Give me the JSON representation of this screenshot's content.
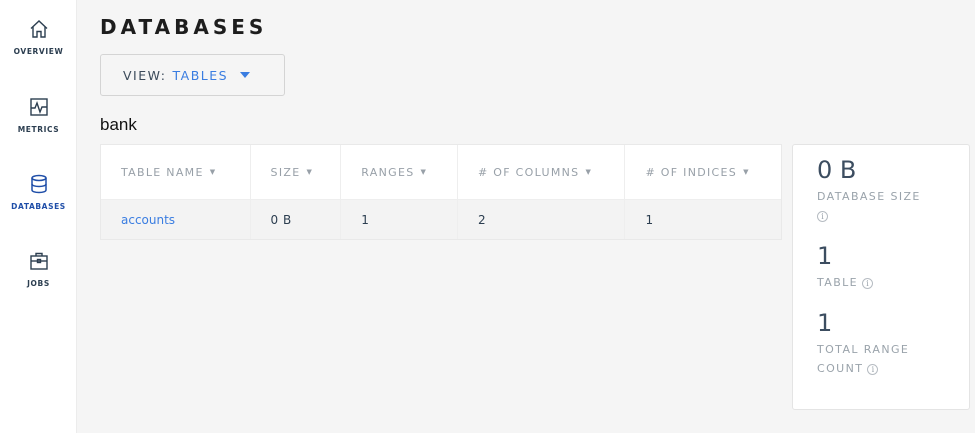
{
  "sidebar": {
    "items": [
      {
        "label": "OVERVIEW",
        "icon": "home-icon",
        "active": false
      },
      {
        "label": "METRICS",
        "icon": "metrics-icon",
        "active": false
      },
      {
        "label": "DATABASES",
        "icon": "database-icon",
        "active": true
      },
      {
        "label": "JOBS",
        "icon": "briefcase-icon",
        "active": false
      }
    ]
  },
  "colors": {
    "accent": "#3a7de1",
    "active_nav": "#1f4ea8",
    "muted_text": "#9aa3ab"
  },
  "page": {
    "title": "DATABASES",
    "view_prefix": "VIEW:",
    "view_value": "TABLES",
    "database_name": "bank"
  },
  "table": {
    "columns": [
      "TABLE NAME",
      "SIZE",
      "RANGES",
      "# OF COLUMNS",
      "# OF INDICES"
    ],
    "rows": [
      [
        "accounts",
        "0 B",
        "1",
        "2",
        "1"
      ]
    ]
  },
  "summary": {
    "database_size": {
      "value": "0 B",
      "label": "DATABASE SIZE"
    },
    "tables": {
      "value": "1",
      "label": "TABLE"
    },
    "total_ranges": {
      "value": "1",
      "label_line1": "TOTAL RANGE",
      "label_line2": "COUNT"
    }
  }
}
